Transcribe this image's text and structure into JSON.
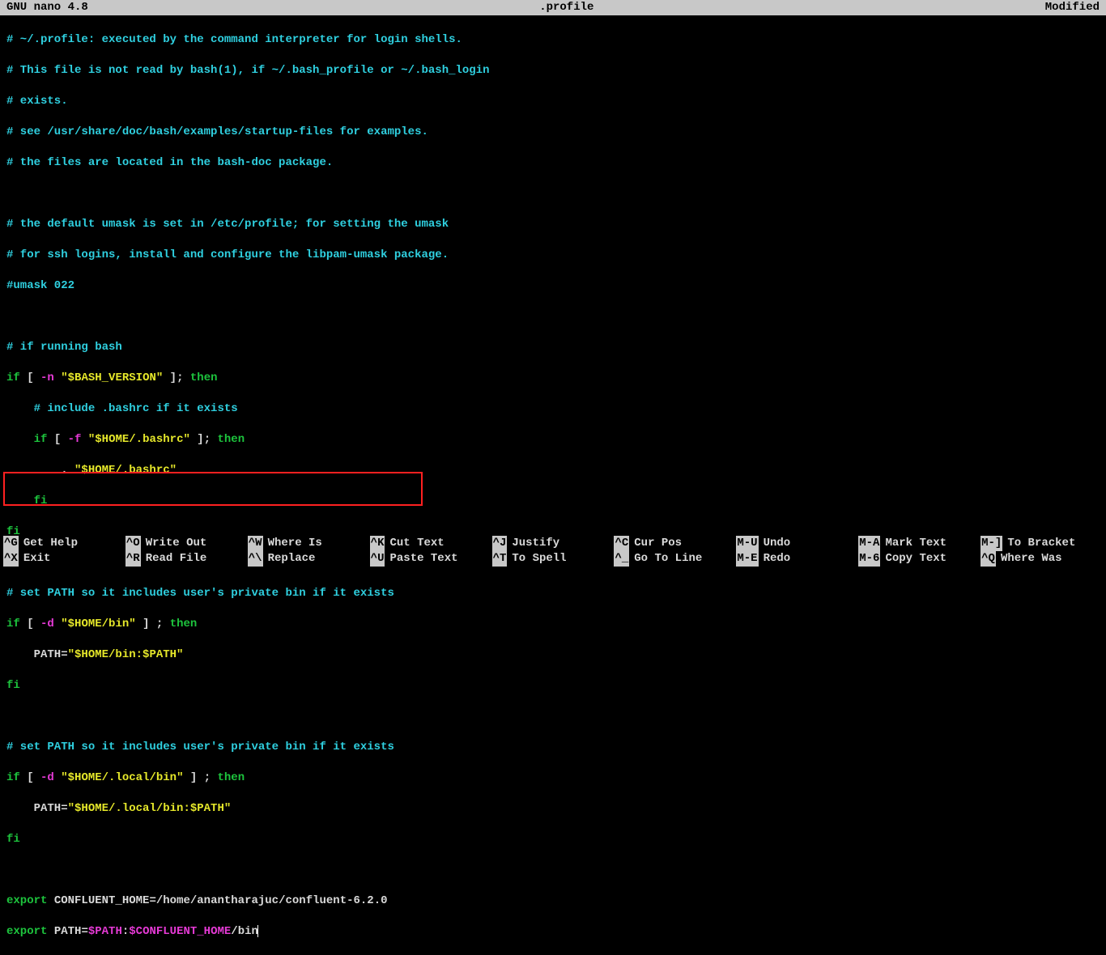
{
  "titlebar": {
    "left": "GNU nano 4.8",
    "center": ".profile",
    "right": "Modified"
  },
  "lines": {
    "l1": "# ~/.profile: executed by the command interpreter for login shells.",
    "l2": "# This file is not read by bash(1), if ~/.bash_profile or ~/.bash_login",
    "l3": "# exists.",
    "l4": "# see /usr/share/doc/bash/examples/startup-files for examples.",
    "l5": "# the files are located in the bash-doc package.",
    "l6": "# the default umask is set in /etc/profile; for setting the umask",
    "l7": "# for ssh logins, install and configure the libpam-umask package.",
    "l8": "#umask 022",
    "l9": "# if running bash",
    "l10_if": "if",
    "l10_b1": " [ ",
    "l10_opt": "-n",
    "l10_sp": " ",
    "l10_str": "\"$BASH_VERSION\"",
    "l10_b2": " ]; ",
    "l10_then": "then",
    "l11": "    # include .bashrc if it exists",
    "l12_pre": "    ",
    "l12_if": "if",
    "l12_b1": " [ ",
    "l12_opt": "-f",
    "l12_sp": " ",
    "l12_str": "\"$HOME/.bashrc\"",
    "l12_b2": " ]; ",
    "l12_then": "then",
    "l13_pre": "        . ",
    "l13_str": "\"$HOME/.bashrc\"",
    "l14_pre": "    ",
    "l14_fi": "fi",
    "l15_fi": "fi",
    "l16": "# set PATH so it includes user's private bin if it exists",
    "l17_if": "if",
    "l17_b1": " [ ",
    "l17_opt": "-d",
    "l17_sp": " ",
    "l17_str": "\"$HOME/bin\"",
    "l17_b2": " ] ; ",
    "l17_then": "then",
    "l18_pre": "    PATH=",
    "l18_str": "\"$HOME/bin:$PATH\"",
    "l19_fi": "fi",
    "l20": "# set PATH so it includes user's private bin if it exists",
    "l21_if": "if",
    "l21_b1": " [ ",
    "l21_opt": "-d",
    "l21_sp": " ",
    "l21_str": "\"$HOME/.local/bin\"",
    "l21_b2": " ] ; ",
    "l21_then": "then",
    "l22_pre": "    PATH=",
    "l22_str": "\"$HOME/.local/bin:$PATH\"",
    "l23_fi": "fi",
    "l24_export": "export",
    "l24_a": " CONFLUENT_HOME",
    "l24_eq": "=",
    "l24_b": "/home/anantharajuc/confluent-6.2.0",
    "l25_export": "export",
    "l25_a": " PATH",
    "l25_eq": "=",
    "l25_var1": "$PATH",
    "l25_colon": ":",
    "l25_var2": "$CONFLUENT_HOME",
    "l25_tail": "/bin"
  },
  "shortcuts": {
    "r1": [
      {
        "key": "^G",
        "label": "Get Help"
      },
      {
        "key": "^O",
        "label": "Write Out"
      },
      {
        "key": "^W",
        "label": "Where Is"
      },
      {
        "key": "^K",
        "label": "Cut Text"
      },
      {
        "key": "^J",
        "label": "Justify"
      },
      {
        "key": "^C",
        "label": "Cur Pos"
      },
      {
        "key": "M-U",
        "label": "Undo"
      },
      {
        "key": "M-A",
        "label": "Mark Text"
      },
      {
        "key": "M-]",
        "label": "To Bracket"
      }
    ],
    "r2": [
      {
        "key": "^X",
        "label": "Exit"
      },
      {
        "key": "^R",
        "label": "Read File"
      },
      {
        "key": "^\\",
        "label": "Replace"
      },
      {
        "key": "^U",
        "label": "Paste Text"
      },
      {
        "key": "^T",
        "label": "To Spell"
      },
      {
        "key": "^_",
        "label": "Go To Line"
      },
      {
        "key": "M-E",
        "label": "Redo"
      },
      {
        "key": "M-6",
        "label": "Copy Text"
      },
      {
        "key": "^Q",
        "label": "Where Was"
      }
    ]
  }
}
